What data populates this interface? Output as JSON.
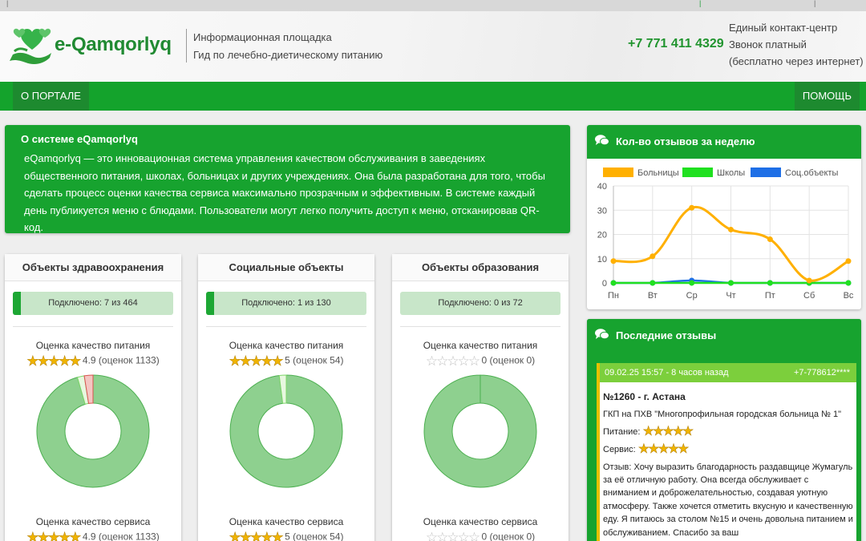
{
  "header": {
    "logo_text": "e-Qamqorlyq",
    "tagline_1": "Информационная площадка",
    "tagline_2": "Гид по лечебно-диетическому питанию",
    "phone": "+7 771 411 4329",
    "contact_1": "Единый контакт-центр",
    "contact_2": "Звонок платный",
    "contact_3": "(бесплатно через интернет)"
  },
  "nav": {
    "about": "О ПОРТАЛЕ",
    "help": "ПОМОЩЬ"
  },
  "about": {
    "title": "О системе eQamqorlyq",
    "text": "eQamqorlyq — это инновационная система управления качеством обслуживания в заведениях общественного питания, школах, больницах и других учреждениях. Она была разработана для того, чтобы сделать процесс оценки качества сервиса максимально прозрачным и эффективным. В системе каждый день публикуется меню с блюдами. Пользователи могут легко получить доступ к меню, отсканировав QR-код."
  },
  "objects": [
    {
      "title": "Объекты здравоохранения",
      "connected": "Подключено: 7 из 464",
      "connected_fraction": 0.015,
      "food_label": "Оценка качество питания",
      "food_stars": 5,
      "food_stars_filled": 4.9,
      "food_score": "4.9",
      "food_count": "(оценок 1133)",
      "donut": [
        0.955,
        0.02,
        0.025
      ],
      "service_label": "Оценка качество сервиса",
      "service_stars_filled": 4.9,
      "service_score": "4.9",
      "service_count": "(оценок 1133)"
    },
    {
      "title": "Социальные объекты",
      "connected": "Подключено: 1 из 130",
      "connected_fraction": 0.008,
      "food_label": "Оценка качество питания",
      "food_stars": 5,
      "food_stars_filled": 5,
      "food_score": "5",
      "food_count": "(оценок 54)",
      "donut": [
        0.98,
        0.02,
        0
      ],
      "service_label": "Оценка качество сервиса",
      "service_stars_filled": 5,
      "service_score": "5",
      "service_count": "(оценок 54)"
    },
    {
      "title": "Объекты образования",
      "connected": "Подключено: 0 из 72",
      "connected_fraction": 0,
      "food_label": "Оценка качество питания",
      "food_stars": 5,
      "food_stars_filled": 0,
      "food_score": "0",
      "food_count": "(оценок 0)",
      "donut": [
        1,
        0,
        0
      ],
      "service_label": "Оценка качество сервиса",
      "service_stars_filled": 0,
      "service_score": "0",
      "service_count": "(оценок 0)"
    }
  ],
  "weekly": {
    "title": "Кол-во отзывов за неделю"
  },
  "chart_data": {
    "type": "line",
    "title": "",
    "xlabel": "",
    "ylabel": "",
    "categories": [
      "Пн",
      "Вт",
      "Ср",
      "Чт",
      "Пт",
      "Сб",
      "Вс"
    ],
    "ylim": [
      0,
      40
    ],
    "yticks": [
      "0",
      "10",
      "20",
      "30",
      "40"
    ],
    "grid": true,
    "legend_position": "top",
    "series": [
      {
        "name": "Больницы",
        "color": "#ffb000",
        "values": [
          9,
          11,
          31,
          22,
          18,
          1,
          9
        ]
      },
      {
        "name": "Школы",
        "color": "#20e020",
        "values": [
          0,
          0,
          0,
          0,
          0,
          0,
          0
        ]
      },
      {
        "name": "Соц.объекты",
        "color": "#1e6fe6",
        "values": [
          0,
          0,
          1,
          0,
          0,
          0,
          0
        ]
      }
    ]
  },
  "reviews": {
    "title": "Последние отзывы",
    "item": {
      "time": "09.02.25 15:57 - 8 часов назад",
      "phone": "+7-778612****",
      "number": "№1260 - г. Астана",
      "org": "ГКП на ПХВ \"Многопрофильная городская больница № 1\"",
      "food_label": "Питание:",
      "food_stars": 5,
      "service_label": "Сервис:",
      "service_stars": 5,
      "text": "Отзыв: Хочу выразить благодарность раздавщице Жумагуль за её отличную работу. Она всегда обслуживает с вниманием и доброжелательностью, создавая уютную атмосферу. Также хочется отметить вкусную и качественную еду. Я питаюсь за столом №15 и очень довольна питанием и обслуживанием. Спасибо за ваш"
    }
  },
  "colors": {
    "brand_green": "#17a32f",
    "dark_green": "#1d8a2f",
    "progress_bg": "#c8e6c9",
    "donut_green": "#8ed08f"
  }
}
